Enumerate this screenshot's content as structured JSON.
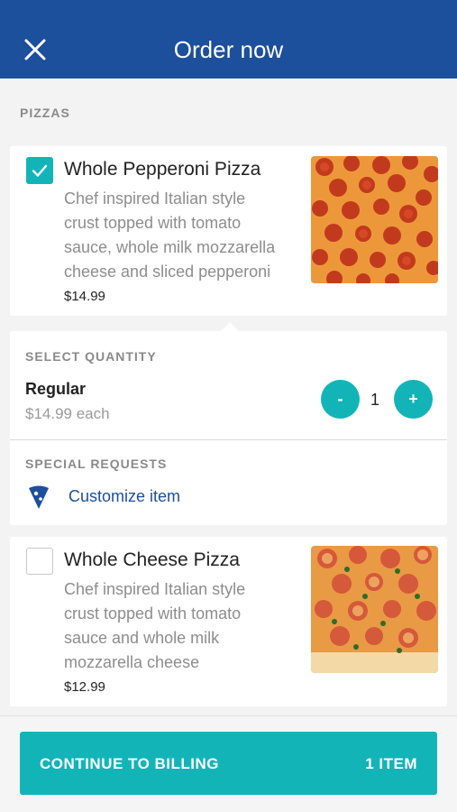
{
  "header": {
    "title": "Order now"
  },
  "section": {
    "label": "PIZZAS"
  },
  "items": [
    {
      "name": "Whole Pepperoni Pizza",
      "desc_lines": [
        "Chef inspired Italian style",
        "crust topped with tomato",
        "sauce, whole milk mozzarella",
        "cheese and sliced pepperoni"
      ],
      "price": "$14.99",
      "checked": true
    },
    {
      "name": "Whole Cheese Pizza",
      "desc_lines": [
        "Chef inspired Italian style",
        "crust topped with tomato",
        "sauce and whole milk",
        "mozzarella cheese"
      ],
      "price": "$12.99",
      "checked": false
    }
  ],
  "quantity": {
    "label": "SELECT QUANTITY",
    "size_name": "Regular",
    "size_price": "$14.99 each",
    "minus": "-",
    "plus": "+",
    "value": "1"
  },
  "special": {
    "label": "SPECIAL REQUESTS",
    "link": "Customize item"
  },
  "cta": {
    "label": "CONTINUE TO BILLING",
    "count": "1 ITEM"
  },
  "colors": {
    "header": "#1c4f9c",
    "accent": "#13b4b8",
    "link": "#1c4f9c"
  },
  "icons": {
    "close": "close-icon",
    "check": "check-icon",
    "customize": "pizza-slice-icon"
  }
}
